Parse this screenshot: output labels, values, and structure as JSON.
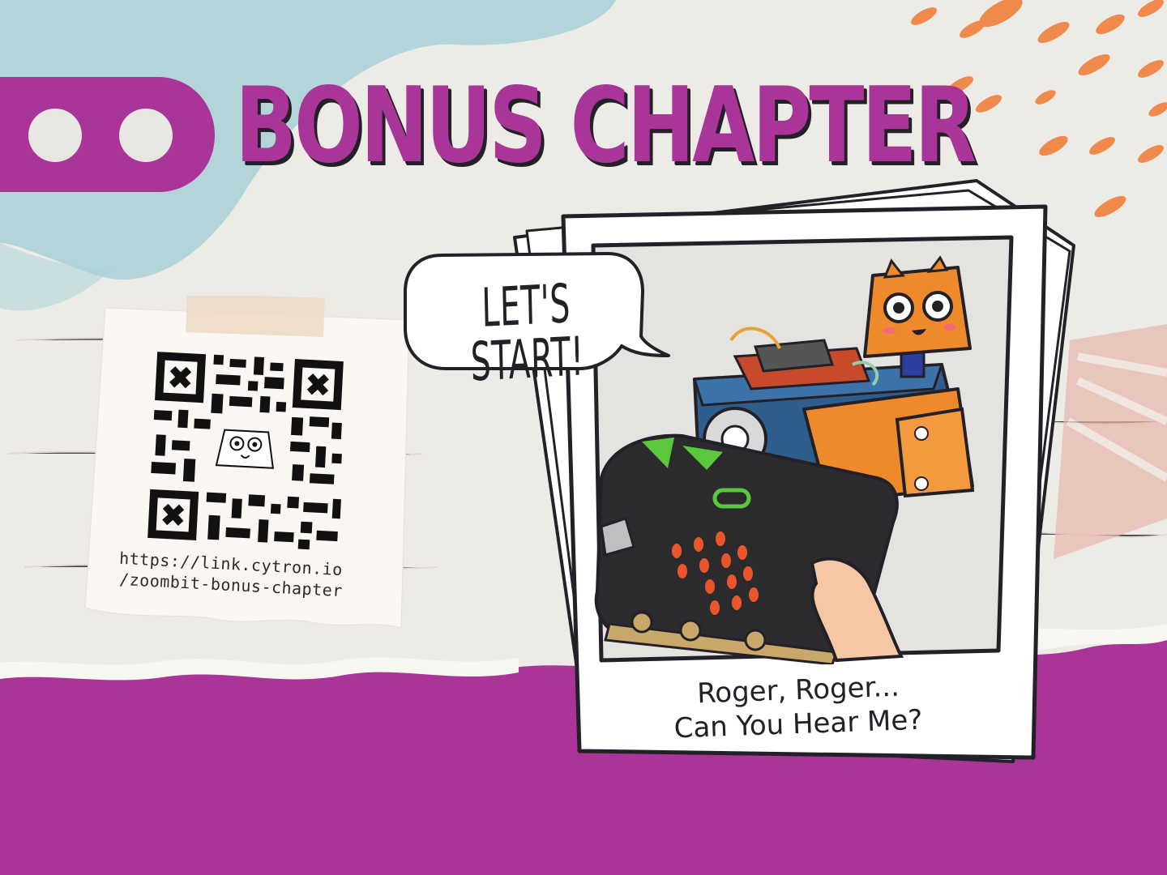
{
  "title": "BONUS CHAPTER",
  "qr_note": {
    "url_line_1": "https://link.cytron.io",
    "url_line_2": "/zoombit-bonus-chapter"
  },
  "speech_bubble": {
    "text": "LET'S START!"
  },
  "photo": {
    "caption_line_1": "Roger, Roger...",
    "caption_line_2": "Can You Hear Me?"
  },
  "colors": {
    "brand_purple": "#a93598",
    "accent_orange": "#ef8a4c",
    "paper": "#ecebe6",
    "teal": "#a9d1d7"
  },
  "icons": [
    "logo-eyes-icon",
    "qr-code-icon",
    "robot-illustration",
    "microbit-board-icon"
  ]
}
